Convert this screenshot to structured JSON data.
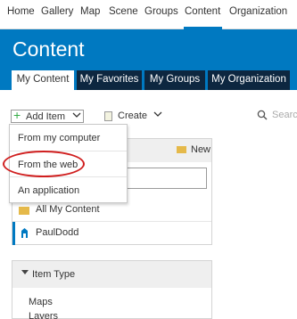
{
  "topnav": {
    "items": [
      {
        "label": "Home"
      },
      {
        "label": "Gallery"
      },
      {
        "label": "Map"
      },
      {
        "label": "Scene"
      },
      {
        "label": "Groups"
      },
      {
        "label": "Content"
      },
      {
        "label": "Organization"
      }
    ],
    "active": "Content"
  },
  "header": {
    "title": "Content",
    "tabs": [
      {
        "label": "My Content"
      },
      {
        "label": "My Favorites"
      },
      {
        "label": "My Groups"
      },
      {
        "label": "My Organization"
      }
    ],
    "active_tab": "My Content"
  },
  "toolbar": {
    "add_item_label": "Add Item",
    "create_label": "Create",
    "search_placeholder": "Searc"
  },
  "add_item_menu": {
    "items": [
      {
        "label": "From my computer"
      },
      {
        "label": "From the web"
      },
      {
        "label": "An application"
      }
    ],
    "circled": "From the web"
  },
  "folders_panel": {
    "new_label": "New",
    "rows": [
      {
        "label": "All My Content",
        "icon": "folder-icon"
      },
      {
        "label": "PaulDodd",
        "icon": "user-icon"
      }
    ]
  },
  "filter_panel": {
    "heading": "Item Type",
    "items": [
      {
        "label": "Maps"
      },
      {
        "label": "Layers"
      }
    ]
  },
  "colors": {
    "brand_blue": "#0079c1",
    "tab_dark": "#0d2740",
    "highlight_red": "#d01f1f"
  }
}
